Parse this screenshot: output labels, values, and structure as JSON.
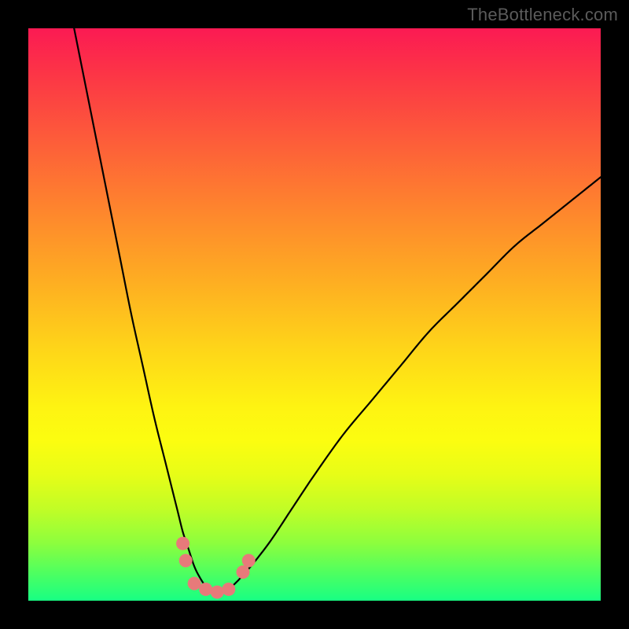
{
  "watermark": "TheBottleneck.com",
  "colors": {
    "frame": "#000000",
    "curve": "#000000",
    "marker_fill": "#e77a7a",
    "marker_stroke": "#d86b6b",
    "gradient_stops": [
      "#fb1a53",
      "#fc3546",
      "#fd5e39",
      "#fe862d",
      "#fead22",
      "#fed519",
      "#fef312",
      "#fcfd10",
      "#e7fd17",
      "#c1fd26",
      "#8cfe3e",
      "#50ff5f",
      "#18ff83"
    ]
  },
  "chart_data": {
    "type": "line",
    "title": "",
    "xlabel": "",
    "ylabel": "",
    "xlim": [
      0,
      100
    ],
    "ylim": [
      0,
      100
    ],
    "series": [
      {
        "name": "left-falling-curve",
        "x": [
          8,
          10,
          12,
          14,
          16,
          18,
          20,
          22,
          24,
          26,
          27,
          28,
          29,
          30,
          31,
          32,
          33
        ],
        "y": [
          100,
          90,
          80,
          70,
          60,
          50,
          41,
          32,
          24,
          16,
          12,
          9,
          6,
          4,
          2.5,
          1.5,
          1
        ]
      },
      {
        "name": "right-rising-curve",
        "x": [
          33,
          35,
          38,
          42,
          46,
          50,
          55,
          60,
          65,
          70,
          75,
          80,
          85,
          90,
          95,
          100
        ],
        "y": [
          1,
          2,
          5,
          10,
          16,
          22,
          29,
          35,
          41,
          47,
          52,
          57,
          62,
          66,
          70,
          74
        ]
      }
    ],
    "markers": [
      {
        "x": 27.0,
        "y": 10.0
      },
      {
        "x": 27.5,
        "y": 7.0
      },
      {
        "x": 29.0,
        "y": 3.0
      },
      {
        "x": 31.0,
        "y": 2.0
      },
      {
        "x": 33.0,
        "y": 1.5
      },
      {
        "x": 35.0,
        "y": 2.0
      },
      {
        "x": 37.5,
        "y": 5.0
      },
      {
        "x": 38.5,
        "y": 7.0
      }
    ]
  }
}
